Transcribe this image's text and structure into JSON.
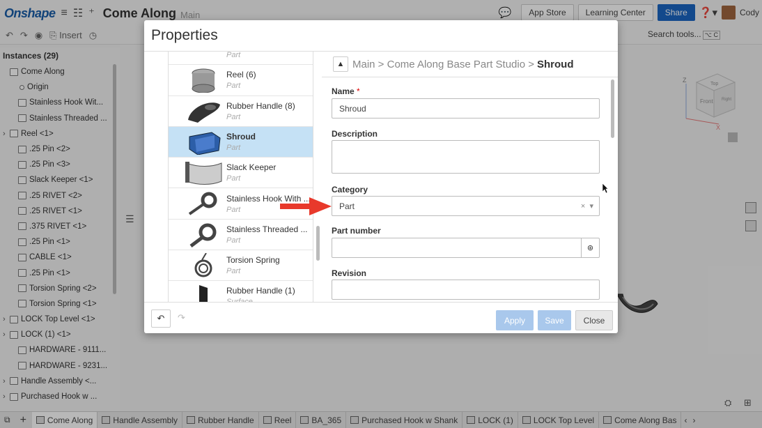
{
  "app": {
    "logo": "Onshape",
    "doc_title": "Come Along",
    "workspace": "Main",
    "buttons": {
      "app_store": "App Store",
      "learning_center": "Learning Center",
      "share": "Share"
    },
    "user": "Cody",
    "toolbar": {
      "insert": "Insert"
    },
    "search_tools": "Search tools...",
    "search_kbd_1": "⌥",
    "search_kbd_2": "C"
  },
  "sidebar": {
    "header": "Instances (29)",
    "items": [
      {
        "label": "Come Along",
        "expand": false,
        "kind": "asm"
      },
      {
        "label": "Origin",
        "expand": false,
        "kind": "origin"
      },
      {
        "label": "Stainless Hook Wit...",
        "expand": false,
        "kind": "part"
      },
      {
        "label": "Stainless Threaded ...",
        "expand": false,
        "kind": "part"
      },
      {
        "label": "Reel <1>",
        "expand": true,
        "kind": "asm"
      },
      {
        "label": ".25 Pin <2>",
        "expand": false,
        "kind": "part"
      },
      {
        "label": ".25 Pin <3>",
        "expand": false,
        "kind": "part"
      },
      {
        "label": "Slack Keeper <1>",
        "expand": false,
        "kind": "part"
      },
      {
        "label": ".25 RIVET <2>",
        "expand": false,
        "kind": "part"
      },
      {
        "label": ".25 RIVET <1>",
        "expand": false,
        "kind": "part"
      },
      {
        "label": ".375 RIVET <1>",
        "expand": false,
        "kind": "part"
      },
      {
        "label": ".25 Pin <1>",
        "expand": false,
        "kind": "part"
      },
      {
        "label": "CABLE <1>",
        "expand": false,
        "kind": "part"
      },
      {
        "label": ".25 Pin <1>",
        "expand": false,
        "kind": "part"
      },
      {
        "label": "Torsion Spring <2>",
        "expand": false,
        "kind": "part"
      },
      {
        "label": "Torsion Spring <1>",
        "expand": false,
        "kind": "part"
      },
      {
        "label": "LOCK Top Level <1>",
        "expand": true,
        "kind": "asm"
      },
      {
        "label": "LOCK (1) <1>",
        "expand": true,
        "kind": "asm"
      },
      {
        "label": "HARDWARE - 9111...",
        "expand": false,
        "kind": "part"
      },
      {
        "label": "HARDWARE - 9231...",
        "expand": false,
        "kind": "part"
      },
      {
        "label": "Handle Assembly <...",
        "expand": true,
        "kind": "asm"
      },
      {
        "label": "Purchased Hook w ...",
        "expand": true,
        "kind": "asm"
      }
    ]
  },
  "bottom_tabs": [
    {
      "label": "Come Along",
      "active": true
    },
    {
      "label": "Handle Assembly",
      "active": false
    },
    {
      "label": "Rubber Handle",
      "active": false
    },
    {
      "label": "Reel",
      "active": false
    },
    {
      "label": "BA_365",
      "active": false
    },
    {
      "label": "Purchased Hook w Shank",
      "active": false
    },
    {
      "label": "LOCK (1)",
      "active": false
    },
    {
      "label": "LOCK Top Level",
      "active": false
    },
    {
      "label": "Come Along Bas",
      "active": false
    }
  ],
  "dialog": {
    "title": "Properties",
    "parts": [
      {
        "name": "",
        "type": "Part",
        "selected": false,
        "thumb": "pin"
      },
      {
        "name": "Reel (6)",
        "type": "Part",
        "selected": false,
        "thumb": "reel"
      },
      {
        "name": "Rubber Handle (8)",
        "type": "Part",
        "selected": false,
        "thumb": "handle"
      },
      {
        "name": "Shroud",
        "type": "Part",
        "selected": true,
        "thumb": "shroud"
      },
      {
        "name": "Slack Keeper",
        "type": "Part",
        "selected": false,
        "thumb": "keeper"
      },
      {
        "name": "Stainless Hook With ...",
        "type": "Part",
        "selected": false,
        "thumb": "hook"
      },
      {
        "name": "Stainless Threaded ...",
        "type": "Part",
        "selected": false,
        "thumb": "hook2"
      },
      {
        "name": "Torsion Spring",
        "type": "Part",
        "selected": false,
        "thumb": "spring"
      },
      {
        "name": "Rubber Handle (1)",
        "type": "Surface",
        "selected": false,
        "thumb": "surface"
      }
    ],
    "breadcrumb": {
      "path": "Main > Come Along Base Part Studio >",
      "current": "Shroud"
    },
    "fields": {
      "name_label": "Name",
      "name_required": "*",
      "name_value": "Shroud",
      "description_label": "Description",
      "description_value": "",
      "category_label": "Category",
      "category_value": "Part",
      "part_number_label": "Part number",
      "part_number_value": "",
      "revision_label": "Revision",
      "revision_value": ""
    },
    "footer": {
      "apply": "Apply",
      "save": "Save",
      "close": "Close"
    }
  },
  "viewcube": {
    "top": "Top",
    "front": "Front",
    "right": "Right",
    "axis_z": "Z",
    "axis_x": "X"
  },
  "colors": {
    "accent": "#1b66c2",
    "selected_row": "#c5e1f5",
    "arrow": "#e8392b",
    "disabled_btn": "#a9c8ec"
  }
}
